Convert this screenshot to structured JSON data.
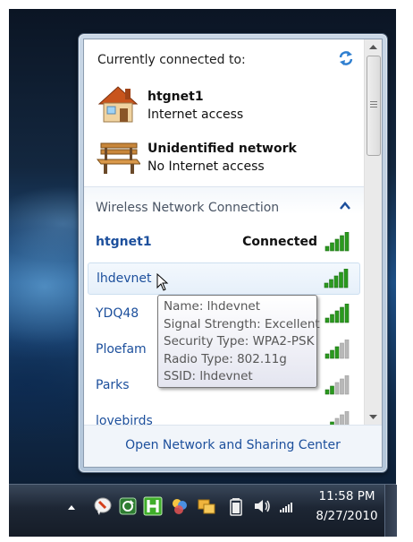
{
  "popup": {
    "currently_connected_label": "Currently connected to:",
    "connections": [
      {
        "name": "htgnet1",
        "status": "Internet access",
        "icon": "house-icon"
      },
      {
        "name": "Unidentified network",
        "status": "No Internet access",
        "icon": "park-bench-icon"
      }
    ],
    "section_header": "Wireless Network Connection",
    "networks": [
      {
        "name": "htgnet1",
        "status": "Connected",
        "signal": 5
      },
      {
        "name": "lhdevnet",
        "status": "",
        "signal": 5
      },
      {
        "name": "YDQ48",
        "status": "",
        "signal": 5
      },
      {
        "name": "Ploefam",
        "status": "",
        "signal": 3
      },
      {
        "name": "Parks",
        "status": "",
        "signal": 2
      },
      {
        "name": "lovebirds",
        "status": "",
        "signal": 2
      }
    ],
    "footer_link": "Open Network and Sharing Center"
  },
  "tooltip": {
    "name": "Name: lhdevnet",
    "signal": "Signal Strength: Excellent",
    "security": "Security Type: WPA2-PSK",
    "radio": "Radio Type: 802.11g",
    "ssid": "SSID: lhdevnet"
  },
  "taskbar": {
    "time": "11:58 PM",
    "date": "8/27/2010",
    "tray_icons": [
      "show-hidden-icons-arrow",
      "notes-icon",
      "recycle-icon",
      "h-app-icon",
      "paint-icon",
      "folders-icon",
      "battery-icon",
      "speaker-icon",
      "network-signal-icon"
    ]
  },
  "colors": {
    "link_blue": "#1c4f9c",
    "signal_green": "#2a9a1e",
    "signal_grey": "#b8b8b8",
    "taskbar": "#1d2634"
  }
}
